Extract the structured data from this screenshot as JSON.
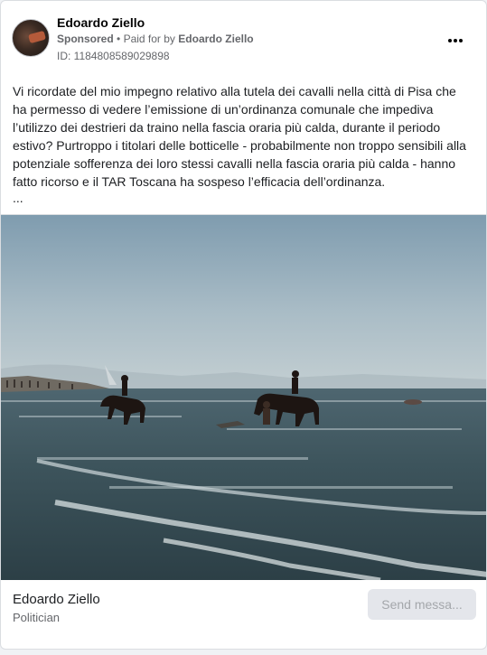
{
  "post": {
    "author": "Edoardo Ziello",
    "sponsored_label": "Sponsored",
    "paid_for_prefix": "Paid for by",
    "paid_for_name": "Edoardo Ziello",
    "separator": "•",
    "ad_id": "ID: 1184808589029898",
    "more_icon": "more-horizontal-icon",
    "text": "Vi ricordate del mio impegno relativo alla tutela dei cavalli nella città di Pisa che ha permesso di vedere l’emissione di un’ordinanza comunale che impediva l’utilizzo dei destrieri da traino nella fascia oraria più calda, durante il periodo estivo? Purtroppo i titolari delle botticelle - probabilmente non troppo sensibili alla potenziale sofferenza dei loro stessi cavalli nella fascia oraria più calda - hanno fatto ricorso e il TAR Toscana ha sospeso l’efficacia dell’ordinanza.",
    "ellipsis": "..."
  },
  "footer": {
    "page_name": "Edoardo Ziello",
    "category": "Politician",
    "send_button": "Send messa..."
  },
  "colors": {
    "text_primary": "#050505",
    "text_secondary": "#65676b",
    "button_bg": "#e4e6eb",
    "button_text": "#a4a7ab",
    "border": "#dadde1"
  }
}
